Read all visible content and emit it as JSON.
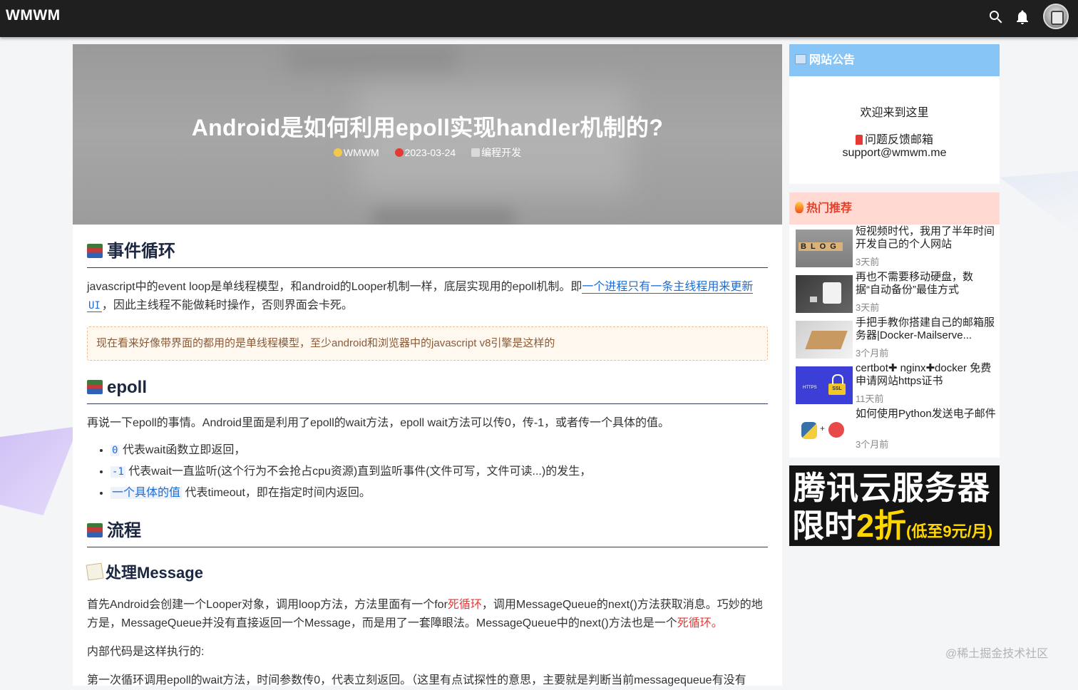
{
  "header": {
    "brand": "WMWM",
    "icons": [
      "search-icon",
      "bell-icon"
    ]
  },
  "article": {
    "title": "Android是如何利用epoll实现handler机制的?",
    "author": "WMWM",
    "date": "2023-03-24",
    "category": "编程开发",
    "sections": {
      "s1": {
        "heading": "事件循环",
        "p1_a": "javascript中的event loop是单线程模型，和android的Looper机制一样，底层实现用的epoll机制。即",
        "p1_link": "一个进程只有一条主线程用来更新",
        "p1_code": "UI",
        "p1_b": "，因此主线程不能做耗时操作，否则界面会卡死。",
        "notice": "现在看来好像带界面的都用的是单线程模型，至少android和浏览器中的javascript v8引擎是这样的"
      },
      "s2": {
        "heading": "epoll",
        "p1": "再说一下epoll的事情。Android里面是利用了epoll的wait方法，epoll wait方法可以传0，传-1，或者传一个具体的值。",
        "items": [
          {
            "code": "0",
            "text": " 代表wait函数立即返回，"
          },
          {
            "code": "-1",
            "text": " 代表wait一直监听(这个行为不会抢占cpu资源)直到监听事件(文件可写，文件可读...)的发生，"
          },
          {
            "code": "一个具体的值",
            "text": " 代表timeout，即在指定时间内返回。"
          }
        ]
      },
      "s3": {
        "heading": "流程",
        "sub": "处理Message",
        "p1_a": "首先Android会创建一个Looper对象，调用loop方法，方法里面有一个for",
        "p1_red1": "死循环",
        "p1_b": "，调用MessageQueue的next()方法获取消息。巧妙的地方是，MessageQueue并没有直接返回一个Message，而是用了一套障眼法。MessageQueue中的next()方法也是一个",
        "p1_red2": "死循环",
        "p1_c": "。",
        "p2": "内部代码是这样执行的:",
        "p3": "第一次循环调用epoll的wait方法，时间参数传0，代表立刻返回。（这里有点试探性的意思，主要就是判断当前messagequeue有没有"
      }
    }
  },
  "sidebar": {
    "notice": {
      "title": "网站公告",
      "welcome": "欢迎来到这里",
      "feedback_label": "问题反馈邮箱",
      "email": "support@wmwm.me"
    },
    "hot": {
      "title": "热门推荐",
      "items": [
        {
          "title": "短视频时代，我用了半年时间开发自己的个人网站",
          "time": "3天前"
        },
        {
          "title": "再也不需要移动硬盘，数据“自动备份”最佳方式",
          "time": "3天前"
        },
        {
          "title": "手把手教你搭建自己的邮箱服务器|Docker-Mailserve...",
          "time": "3个月前"
        },
        {
          "title": "certbot✚ nginx✚docker 免费申请网站https证书",
          "time": "11天前"
        },
        {
          "title": "如何使用Python发送电子邮件",
          "time": "3个月前"
        }
      ],
      "thumb_texts": {
        "blog": "BLOG",
        "ssl": "SSL",
        "https": "HTTPS"
      }
    },
    "ad": {
      "line1": "腾讯云服务器",
      "line2_a": "限时",
      "line2_b": "2折",
      "line2_c": "(低至9元/月)"
    }
  },
  "watermark": "@稀土掘金技术社区",
  "colors": {
    "topbar": "#1f1f1f",
    "notice_head": "#86c5f6",
    "hot_head": "#ffd9d2",
    "link": "#1e6bd6",
    "accent_red": "#e53935"
  }
}
